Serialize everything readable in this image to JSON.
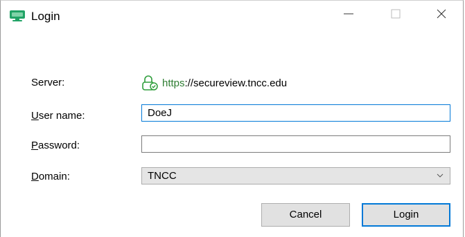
{
  "window": {
    "title": "Login",
    "icon": "monitor-icon",
    "controls": [
      "minimize-icon",
      "maximize-icon",
      "close-icon"
    ]
  },
  "form": {
    "server": {
      "label": "Server:",
      "scheme": "https",
      "rest": "://secureview.tncc.edu",
      "icon": "secure-lock-icon"
    },
    "username": {
      "label_u": "U",
      "label_rest": "ser name:",
      "value": "DoeJ"
    },
    "password": {
      "label_u": "P",
      "label_rest": "assword:",
      "value": ""
    },
    "domain": {
      "label_u": "D",
      "label_rest": "omain:",
      "selected": "TNCC"
    }
  },
  "buttons": {
    "cancel": "Cancel",
    "login": "Login"
  },
  "colors": {
    "accent": "#0078d7",
    "secure_green": "#2e7d32"
  }
}
